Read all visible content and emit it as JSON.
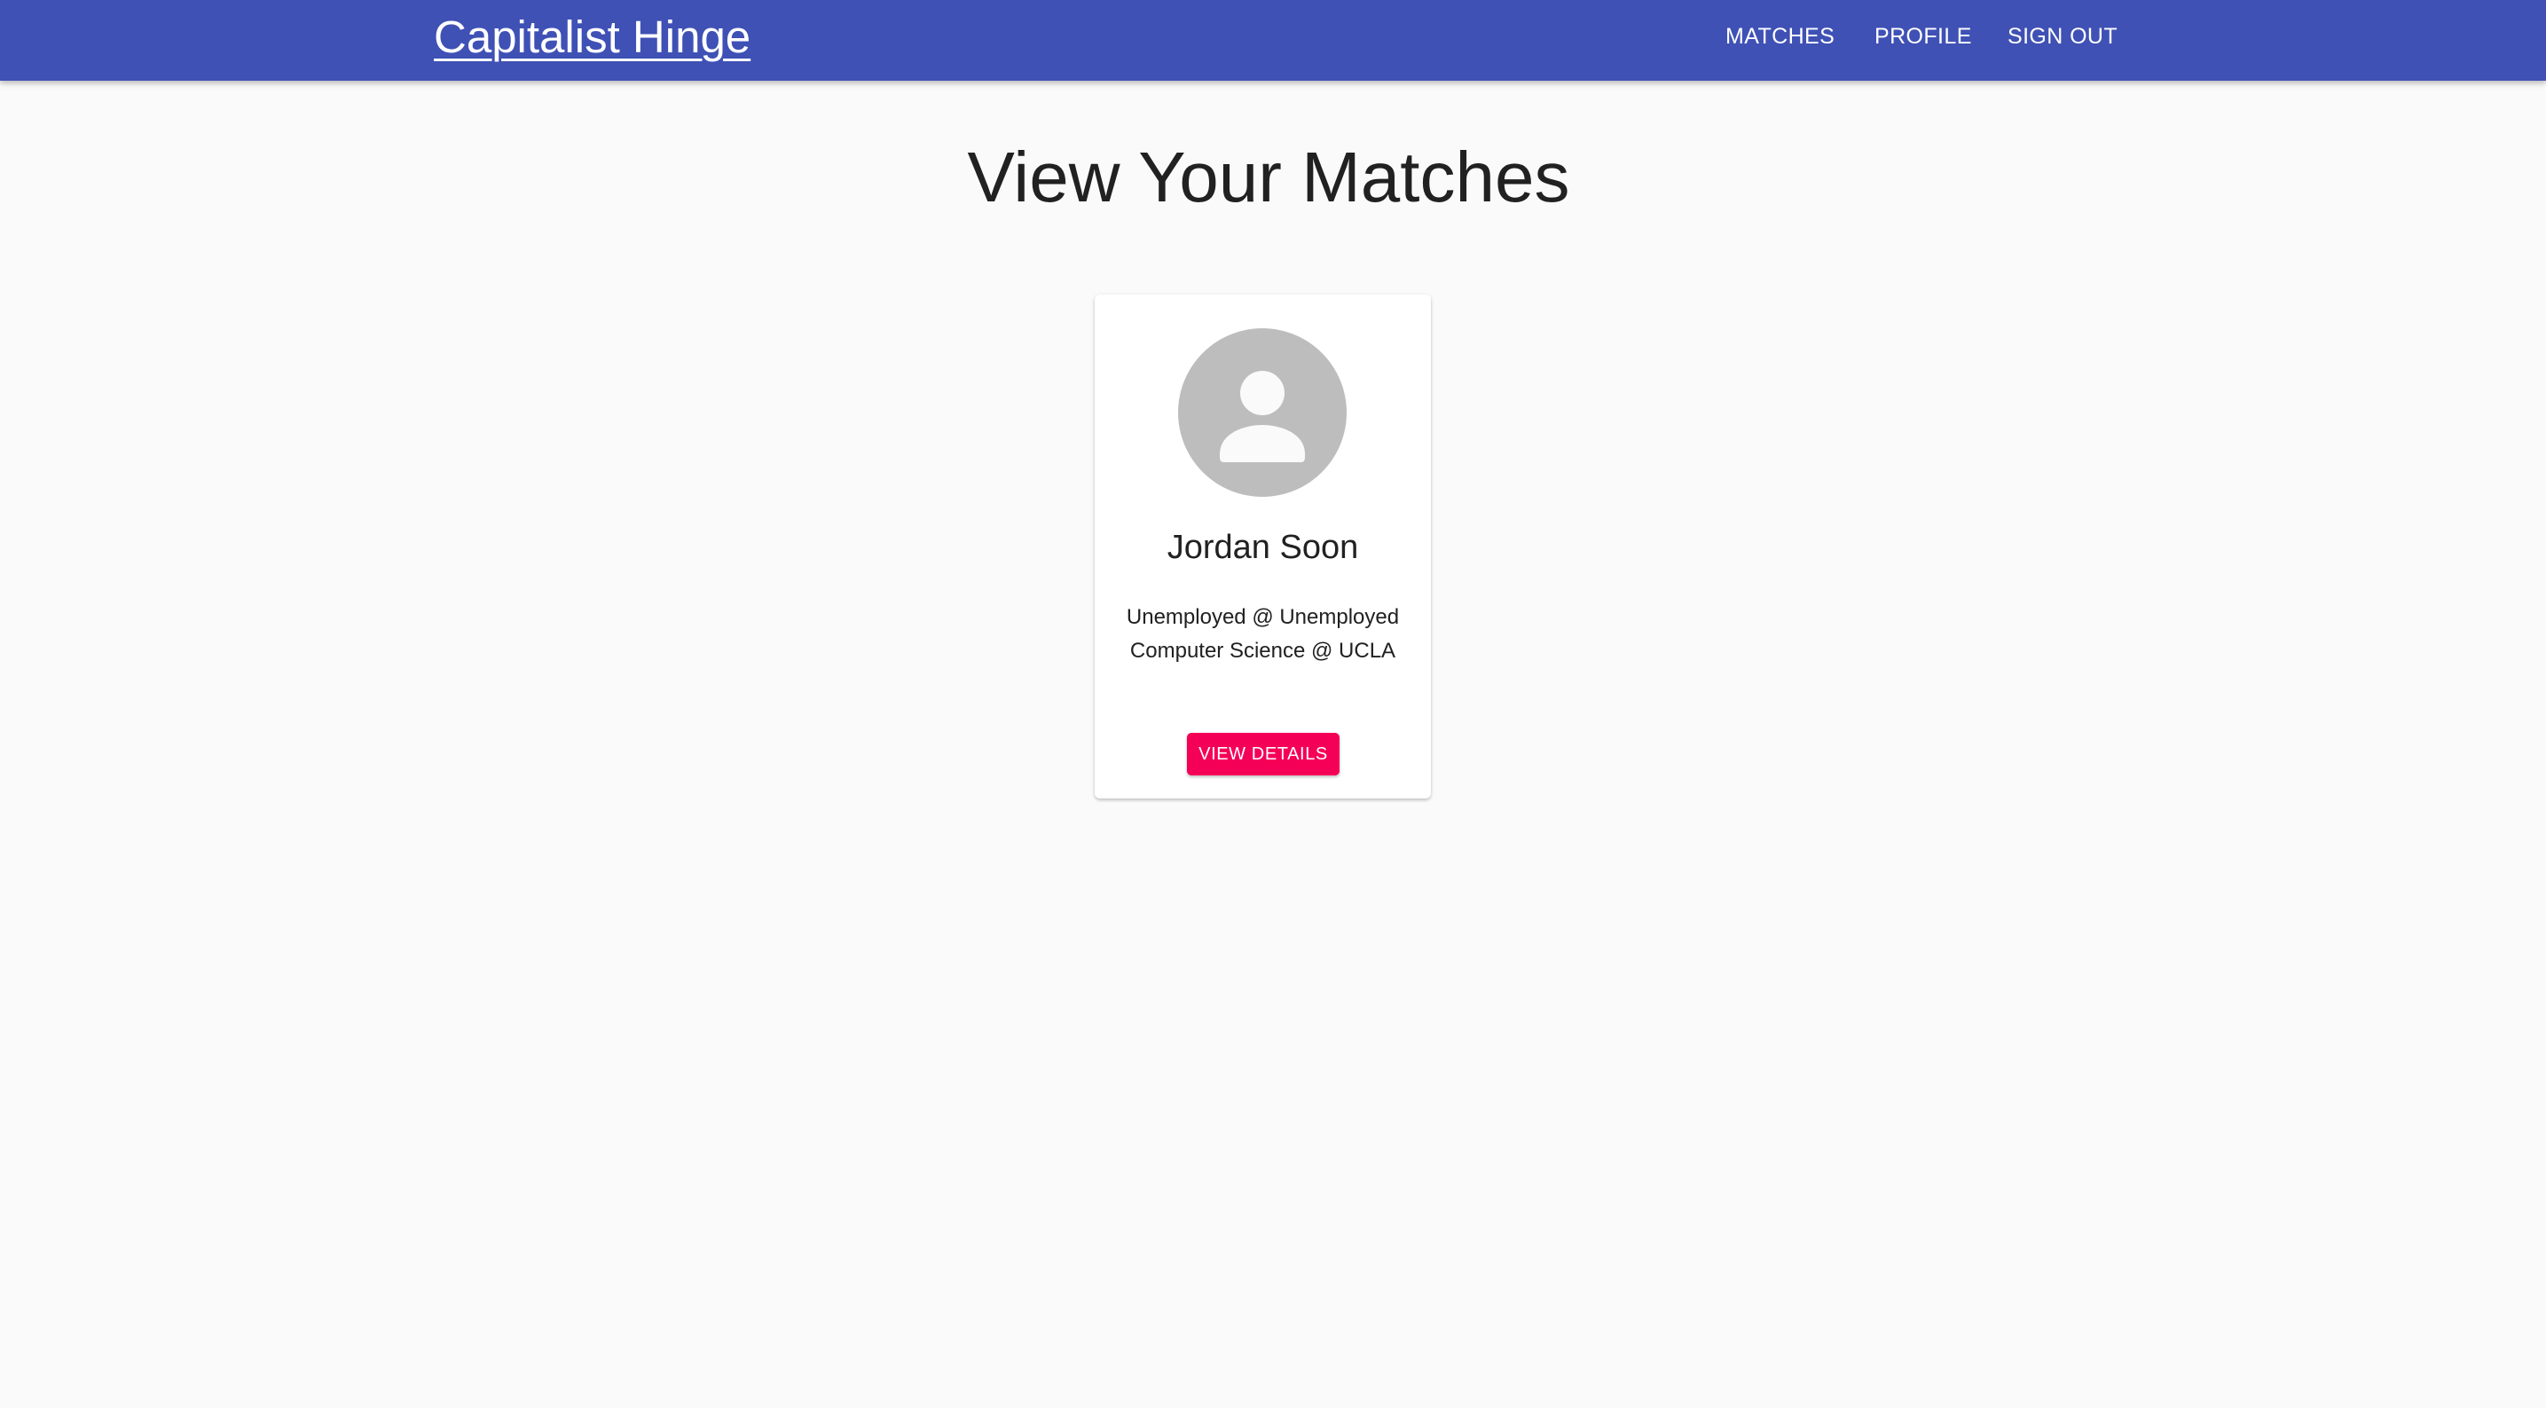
{
  "appbar": {
    "brand": "Capitalist Hinge",
    "nav": {
      "matches": "MATCHES",
      "profile": "PROFILE",
      "sign_out": "SIGN OUT"
    },
    "background_color": "#3f51b5"
  },
  "main": {
    "title": "View Your Matches",
    "matches": [
      {
        "name": "Jordan Soon",
        "job": "Unemployed @ Unemployed",
        "school": "Computer Science @ UCLA",
        "avatar_icon": "person-icon",
        "button_label": "VIEW DETAILS",
        "button_color": "#f50057"
      }
    ]
  }
}
